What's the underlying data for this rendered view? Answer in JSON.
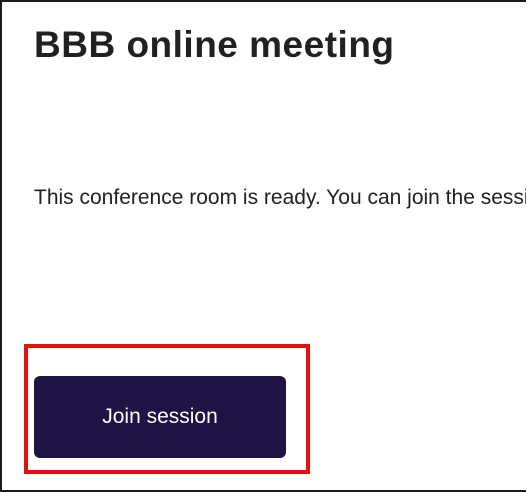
{
  "page": {
    "title": "BBB online meeting",
    "status_text": "This conference room is ready. You can join the session now."
  },
  "actions": {
    "join_label": "Join session"
  },
  "colors": {
    "button_bg": "#1f1346",
    "button_text": "#ffffff",
    "highlight": "#e8100c",
    "text": "#212121"
  }
}
